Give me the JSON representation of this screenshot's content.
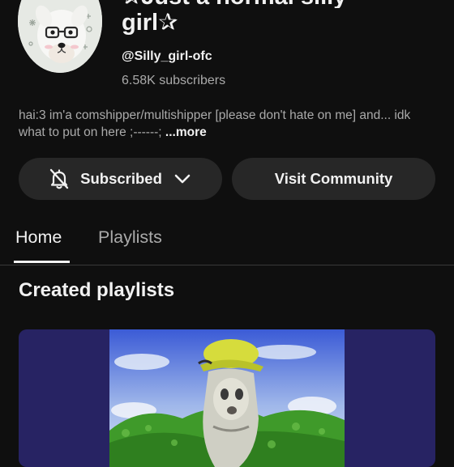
{
  "channel": {
    "name_line1": "✰Just a normal silly",
    "name_line2": "girl✰",
    "handle": "@Silly_girl-ofc",
    "subscribers": "6.58K subscribers",
    "bio": "hai:3 im'a comshipper/multishipper [please don't hate on me] and... idk what to put on here ;------;",
    "bio_more": "...more"
  },
  "actions": {
    "subscribed_label": "Subscribed",
    "visit_community_label": "Visit Community"
  },
  "tabs": [
    {
      "label": "Home",
      "selected": true
    },
    {
      "label": "Playlists",
      "selected": false
    }
  ],
  "sections": {
    "created_playlists_title": "Created playlists"
  },
  "icons": {
    "subscribed_bell": "bell-off-icon",
    "subscribed_menu": "chevron-down-icon"
  },
  "colors": {
    "background": "#0f0f0f",
    "button_bg": "#272727",
    "secondary_text": "#aaaaaa",
    "primary_text": "#f1f1f1"
  }
}
